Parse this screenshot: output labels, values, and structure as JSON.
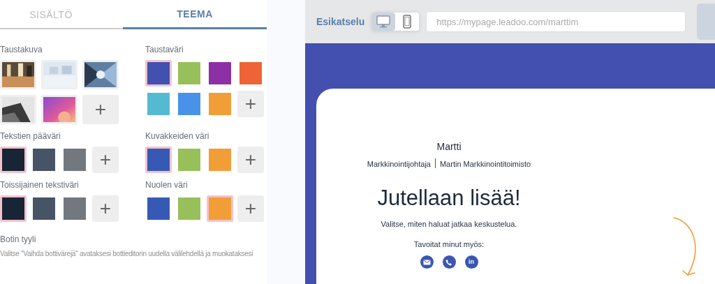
{
  "tabs": [
    {
      "label": "SISÄLTÖ",
      "selected": false
    },
    {
      "label": "TEEMA",
      "selected": true
    }
  ],
  "sections": [
    {
      "label": "Taustakuva",
      "add_button": "+"
    },
    {
      "label": "Taustaväri",
      "kind": "color",
      "swatches": [
        {
          "color": "#4250b0",
          "selected": true
        },
        {
          "color": "#98c05a",
          "selected": false
        },
        {
          "color": "#8e30a5",
          "selected": false
        },
        {
          "color": "#ee6337",
          "selected": false
        },
        {
          "color": "#56b9d2",
          "selected": false
        },
        {
          "color": "#4892ea",
          "selected": false
        },
        {
          "color": "#f29e38",
          "selected": false
        }
      ],
      "add_button": "+"
    },
    {
      "label": "Tekstien pääväri",
      "kind": "color",
      "swatches": [
        {
          "color": "#172535",
          "selected": true
        },
        {
          "color": "#475465",
          "selected": false
        },
        {
          "color": "#72787e",
          "selected": false
        }
      ],
      "add_button": "+"
    },
    {
      "label": "Kuvakkeiden väri",
      "kind": "color",
      "swatches": [
        {
          "color": "#365ab4",
          "selected": true
        },
        {
          "color": "#98c05a",
          "selected": false
        },
        {
          "color": "#f29e38",
          "selected": false
        }
      ],
      "add_button": "+"
    },
    {
      "label": "Toissijainen tekstiväri",
      "kind": "color",
      "swatches": [
        {
          "color": "#172535",
          "selected": true
        },
        {
          "color": "#475465",
          "selected": false
        },
        {
          "color": "#72787e",
          "selected": false
        }
      ],
      "add_button": "+"
    },
    {
      "label": "Nuolen väri",
      "kind": "color",
      "swatches": [
        {
          "color": "#365ab4",
          "selected": false
        },
        {
          "color": "#98c05a",
          "selected": false
        },
        {
          "color": "#f29e38",
          "selected": true
        }
      ],
      "add_button": "+"
    }
  ],
  "bot_style": {
    "label": "Botin tyyli",
    "text": "Valitse \"Vaihda bottivärejä\" avataksesi bottieditorin uudella välilehdellä ja muokataksesi"
  },
  "preview": {
    "label": "Esikatselu",
    "devices": [
      {
        "kind": "desktop",
        "selected": true
      },
      {
        "kind": "mobile",
        "selected": false
      }
    ],
    "url": "https://mypage.leadoo.com/marttim",
    "name": "Martti",
    "role": "Markkinointijohtaja",
    "company": "Martin Markkinointitoimisto",
    "heading": "Jutellaan lisää!",
    "subtext": "Valitse, miten haluat jatkaa keskustelua.",
    "contact_label": "Tavoitat minut myös:",
    "contacts": [
      {
        "kind": "email"
      },
      {
        "kind": "phone"
      },
      {
        "kind": "linkedin",
        "text": "in"
      }
    ]
  }
}
